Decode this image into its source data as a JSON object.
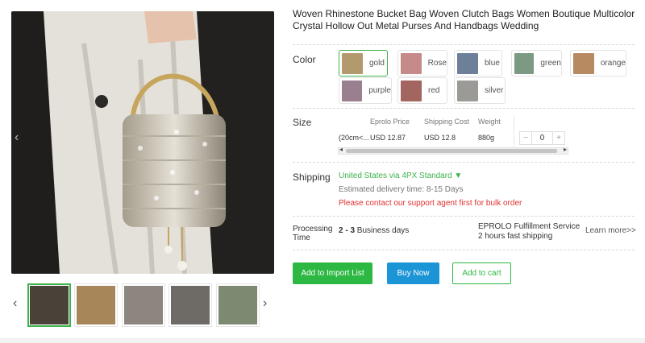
{
  "product": {
    "title": "Woven Rhinestone Bucket Bag Woven Clutch Bags Women Boutique Multicolor Crystal Hollow Out Metal Purses And Handbags Wedding"
  },
  "gallery": {
    "prev_arrow": "‹",
    "next_arrow": "›",
    "main_prev": "‹",
    "thumbs": [
      {
        "color": "#4a4238",
        "active": true
      },
      {
        "color": "#a7865a",
        "active": false
      },
      {
        "color": "#8d8680",
        "active": false
      },
      {
        "color": "#6e6b66",
        "active": false
      },
      {
        "color": "#7d8a72",
        "active": false
      }
    ]
  },
  "color": {
    "label": "Color",
    "options": [
      {
        "name": "gold",
        "swatch": "#b39a6e",
        "selected": true
      },
      {
        "name": "Rose",
        "swatch": "#c78a8a",
        "selected": false
      },
      {
        "name": "blue",
        "swatch": "#6d7f99",
        "selected": false
      },
      {
        "name": "green",
        "swatch": "#7c9a83",
        "selected": false
      },
      {
        "name": "orange",
        "swatch": "#b78a62",
        "selected": false
      },
      {
        "name": "purple",
        "swatch": "#9a7f8f",
        "selected": false
      },
      {
        "name": "red",
        "swatch": "#a2655f",
        "selected": false
      },
      {
        "name": "silver",
        "swatch": "#9b9a97",
        "selected": false
      }
    ]
  },
  "size": {
    "label": "Size",
    "headers": [
      "Eprolo Price",
      "Shipping Cost",
      "Weight"
    ],
    "row": {
      "variant": "(20cm<...",
      "price": "USD 12.87",
      "shipping": "USD 12.8",
      "weight": "880g",
      "quantity": "0"
    },
    "minus": "−",
    "plus": "+",
    "scroll_left": "◂",
    "scroll_right": "▸"
  },
  "shipping": {
    "label": "Shipping",
    "method": "United States via 4PX Standard ▼",
    "delivery": "Estimated delivery time: 8-15 Days",
    "warning": "Please contact our support agent first for bulk order"
  },
  "processing": {
    "label_line1": "Processing",
    "label_line2": "Time",
    "days_bold": "2 - 3",
    "days_rest": " Business days",
    "service_line1": "EPROLO Fulfillment Service",
    "service_line2": "2 hours fast shipping",
    "learn_more": "Learn more>>"
  },
  "actions": {
    "import": "Add to Import List",
    "buy": "Buy Now",
    "cart": "Add to cart"
  },
  "colors": {
    "accent_green": "#2db843",
    "buy_blue": "#1c95d6",
    "warning_red": "#e03131"
  }
}
